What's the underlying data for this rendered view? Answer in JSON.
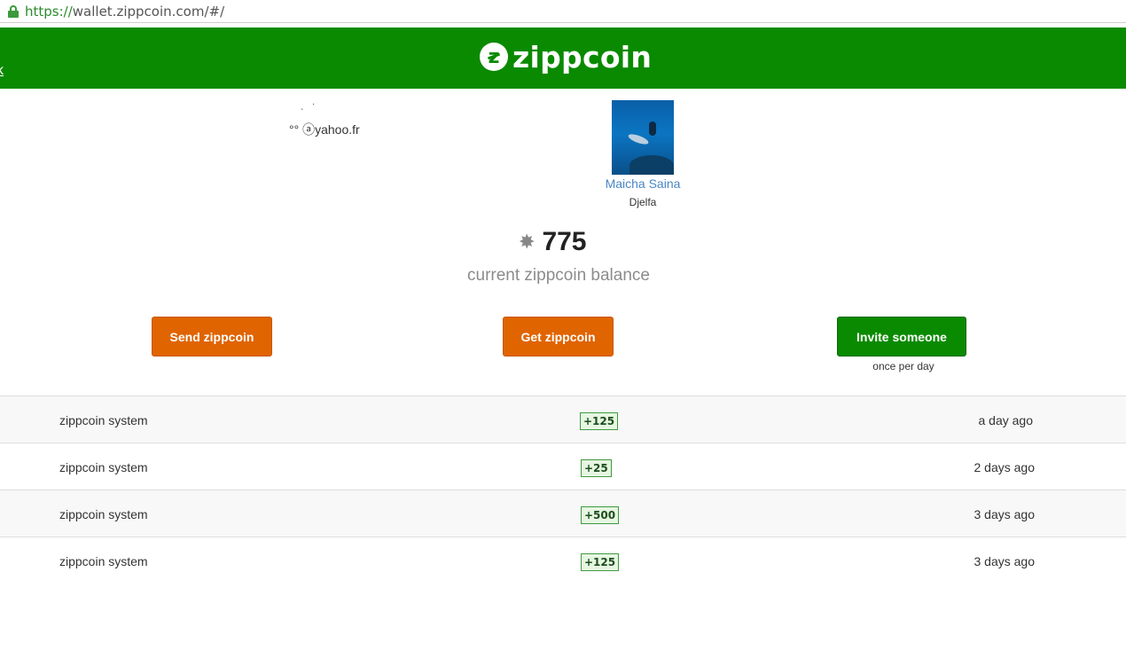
{
  "browser": {
    "url_scheme": "https://",
    "url_rest": "wallet.zippcoin.com/#/"
  },
  "header": {
    "back_link": "k",
    "logo_badge": "z",
    "logo_text": "zippcoin",
    "bg_color": "#0a8a00"
  },
  "profile": {
    "email_prefix_marks": [
      "·",
      "`"
    ],
    "email": "°° ⓐyahoo.fr",
    "name": "Maicha Saina",
    "city": "Djelfa"
  },
  "balance": {
    "icon": "asterisk-icon",
    "icon_glyph": "✸",
    "amount": "775",
    "label": "current zippcoin balance"
  },
  "actions": {
    "send_label": "Send zippcoin",
    "get_label": "Get zippcoin",
    "invite_label": "Invite someone",
    "invite_note": "once per day",
    "orange": "#e06400",
    "green": "#0a8a00"
  },
  "transactions": [
    {
      "from": "zippcoin system",
      "amount": "+125",
      "time": "a day ago"
    },
    {
      "from": "zippcoin system",
      "amount": "+25",
      "time": "2 days ago"
    },
    {
      "from": "zippcoin system",
      "amount": "+500",
      "time": "3 days ago"
    },
    {
      "from": "zippcoin system",
      "amount": "+125",
      "time": "3 days ago"
    }
  ]
}
